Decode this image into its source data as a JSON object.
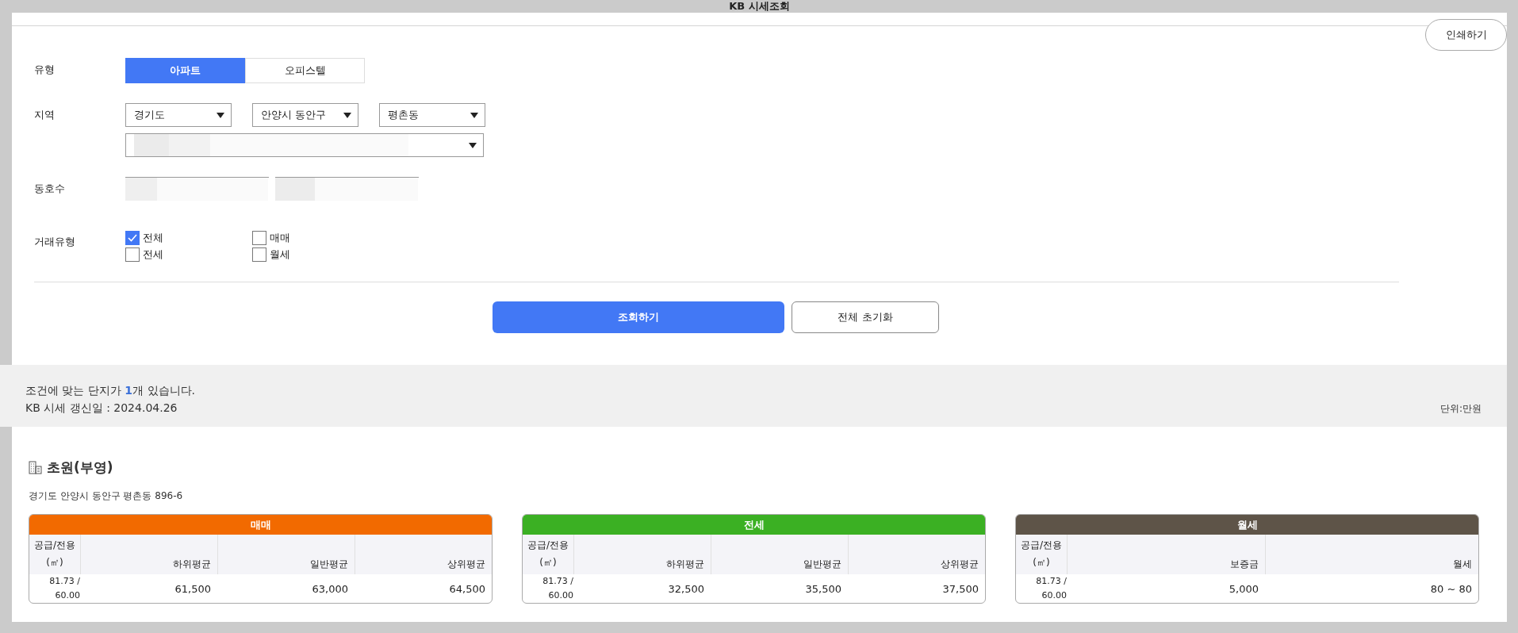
{
  "window": {
    "title": "KB 시세조회"
  },
  "print_button": "인쇄하기",
  "filters": {
    "type": {
      "label": "유형",
      "options": [
        {
          "label": "아파트",
          "selected": true
        },
        {
          "label": "오피스텔",
          "selected": false
        }
      ]
    },
    "region": {
      "label": "지역",
      "selects": [
        "경기도",
        "안양시 동안구",
        "평촌동"
      ]
    },
    "unit_number": {
      "label": "동호수"
    },
    "deal_type": {
      "label": "거래유형",
      "options": [
        {
          "label": "전체",
          "checked": true
        },
        {
          "label": "매매",
          "checked": false
        },
        {
          "label": "전세",
          "checked": false
        },
        {
          "label": "월세",
          "checked": false
        }
      ]
    }
  },
  "buttons": {
    "search": "조회하기",
    "reset": "전체 초기화"
  },
  "summary": {
    "result_text": "조건에 맞는 단지가 **1**개 있습니다.",
    "updated": "KB 시세 갱신일 : 2024.04.26",
    "unit": "단위:만원"
  },
  "complex": {
    "name": "초원(부영)",
    "address": "경기도 안양시 동안구 평촌동 896-6"
  },
  "price_tables": [
    {
      "title": "매매",
      "color": "#f26a00",
      "columns": [
        "공급/전용 (㎡)",
        "하위평균",
        "일반평균",
        "상위평균"
      ],
      "rows": [
        [
          "81.73 / 60.00",
          "61,500",
          "63,000",
          "64,500"
        ]
      ]
    },
    {
      "title": "전세",
      "color": "#3bb023",
      "columns": [
        "공급/전용 (㎡)",
        "하위평균",
        "일반평균",
        "상위평균"
      ],
      "rows": [
        [
          "81.73 / 60.00",
          "32,500",
          "35,500",
          "37,500"
        ]
      ]
    },
    {
      "title": "월세",
      "color": "#5e5448",
      "columns": [
        "공급/전용 (㎡)",
        "보증금",
        "월세"
      ],
      "rows": [
        [
          "81.73 / 60.00",
          "5,000",
          "80 ~ 80"
        ]
      ]
    }
  ]
}
